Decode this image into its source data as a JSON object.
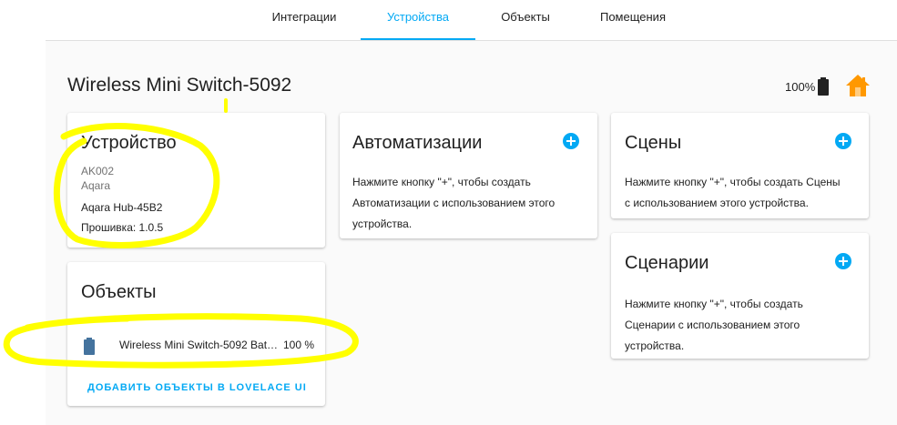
{
  "tabs": [
    {
      "label": "Интеграции",
      "active": false
    },
    {
      "label": "Устройства",
      "active": true
    },
    {
      "label": "Объекты",
      "active": false
    },
    {
      "label": "Помещения",
      "active": false
    }
  ],
  "page": {
    "title": "Wireless Mini Switch-5092",
    "battery_percent": "100%"
  },
  "device_card": {
    "title": "Устройство",
    "model": "AK002",
    "manufacturer": "Aqara",
    "hub": "Aqara Hub-45B2",
    "firmware": "Прошивка: 1.0.5"
  },
  "entities_card": {
    "title": "Объекты",
    "entity_name": "Wireless Mini Switch-5092 Bat…",
    "entity_state": "100 %",
    "add_button_label": "ДОБАВИТЬ ОБЪЕКТЫ В LOVELACE UI"
  },
  "automations_card": {
    "title": "Автоматизации",
    "line1": "Нажмите кнопку \"+\", чтобы создать",
    "line2": "Автоматизации с использованием этого",
    "line3": "устройства."
  },
  "scenes_card": {
    "title": "Сцены",
    "line1": "Нажмите кнопку \"+\", чтобы создать Сцены",
    "line2": "с использованием этого устройства."
  },
  "scripts_card": {
    "title": "Сценарии",
    "line1": "Нажмите кнопку \"+\", чтобы создать",
    "line2": "Сценарии с использованием этого",
    "line3": "устройства."
  },
  "colors": {
    "accent": "#03a9f4",
    "battery_icon": "#44739e",
    "home_icon": "#ff9800",
    "highlight": "#ffff00"
  },
  "icons": {
    "battery": "battery-icon",
    "home": "home-icon",
    "add": "plus-circle-icon",
    "entity_battery": "battery-icon"
  }
}
